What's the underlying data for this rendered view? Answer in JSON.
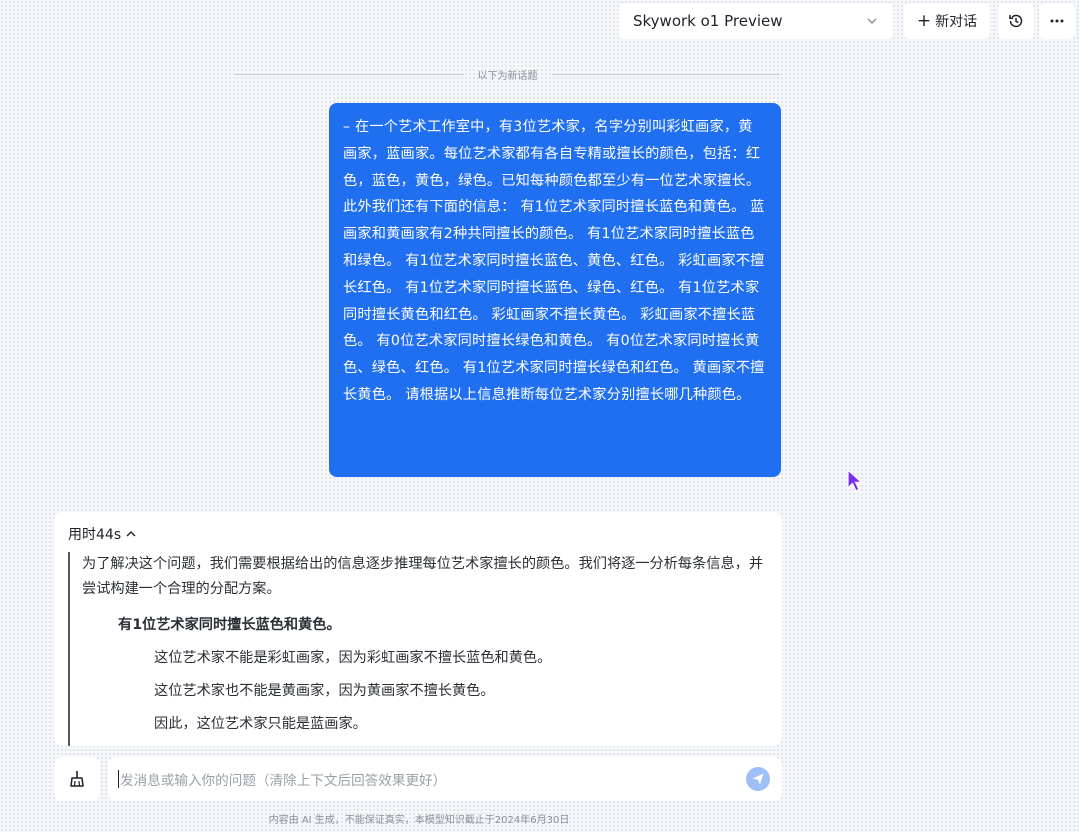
{
  "header": {
    "model_name": "Skywork o1 Preview",
    "new_chat_label": "新对话",
    "new_chat_plus": "+"
  },
  "divider_label": "以下为新话题",
  "user_message": "– 在一个艺术工作室中，有3位艺术家，名字分别叫彩虹画家，黄画家，蓝画家。每位艺术家都有各自专精或擅长的颜色，包括：红色，蓝色，黄色，绿色。已知每种颜色都至少有一位艺术家擅长。此外我们还有下面的信息： 有1位艺术家同时擅长蓝色和黄色。 蓝画家和黄画家有2种共同擅长的颜色。 有1位艺术家同时擅长蓝色和绿色。 有1位艺术家同时擅长蓝色、黄色、红色。 彩虹画家不擅长红色。 有1位艺术家同时擅长蓝色、绿色、红色。 有1位艺术家同时擅长黄色和红色。 彩虹画家不擅长黄色。 彩虹画家不擅长蓝色。 有0位艺术家同时擅长绿色和黄色。 有0位艺术家同时擅长黄色、绿色、红色。 有1位艺术家同时擅长绿色和红色。 黄画家不擅长黄色。 请根据以上信息推断每位艺术家分别擅长哪几种颜色。",
  "answer": {
    "think_label": "用时44s",
    "intro": "为了解决这个问题，我们需要根据给出的信息逐步推理每位艺术家擅长的颜色。我们将逐一分析每条信息，并尝试构建一个合理的分配方案。",
    "heading": "有1位艺术家同时擅长蓝色和黄色。",
    "lines": [
      "这位艺术家不能是彩虹画家，因为彩虹画家不擅长蓝色和黄色。",
      "这位艺术家也不能是黄画家，因为黄画家不擅长黄色。",
      "因此，这位艺术家只能是蓝画家。"
    ]
  },
  "composer": {
    "placeholder": "发消息或输入你的问题（清除上下文后回答效果更好）"
  },
  "disclaimer": "内容由 AI 生成，不能保证真实，本模型知识截止于2024年6月30日",
  "colors": {
    "accent": "#1f6ff0",
    "send_disabled": "#9ec0f7",
    "cursor": "#7b2ff0"
  },
  "icons": [
    "chevron-down-icon",
    "plus-icon",
    "history-icon",
    "more-icon",
    "chevron-up-icon",
    "broom-icon",
    "send-icon",
    "cursor-icon"
  ]
}
